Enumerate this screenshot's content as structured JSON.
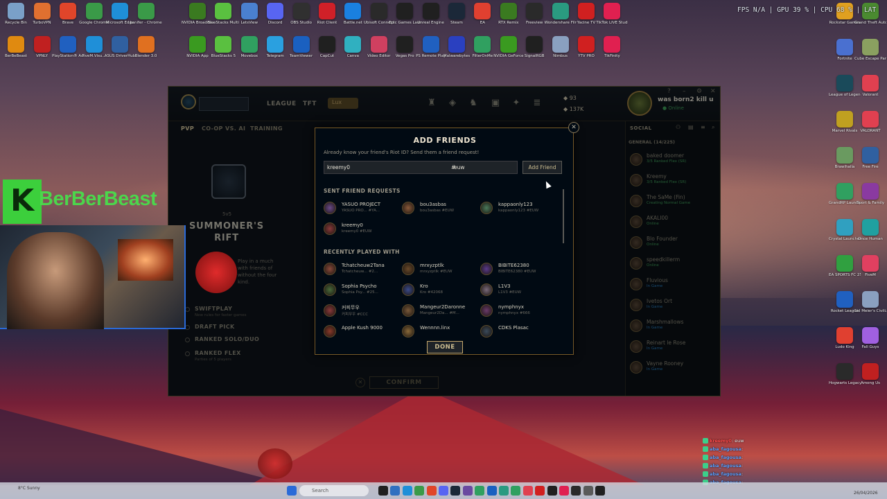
{
  "desktop": {
    "icons_left": [
      {
        "label": "Recycle Bin",
        "color": "#7aa0c8"
      },
      {
        "label": "TurboVPN",
        "color": "#e07030"
      },
      {
        "label": "Brave",
        "color": "#e0452a"
      },
      {
        "label": "Google Chrome",
        "color": "#3a9a48"
      },
      {
        "label": "Microsoft Edge",
        "color": "#1f8fd8"
      },
      {
        "label": "kanifer - Chrome",
        "color": "#3a9a48"
      }
    ],
    "icons_left_row2": [
      {
        "label": "BerBeBeast",
        "color": "#e08a10"
      },
      {
        "label": "VPNLY",
        "color": "#c02020"
      },
      {
        "label": "PlayStation® Accessories",
        "color": "#2060c0"
      },
      {
        "label": "FiveM.Visu...",
        "color": "#1f8fd8"
      },
      {
        "label": "ASUS DriverHub",
        "color": "#3060a0"
      },
      {
        "label": "Blender 3.0",
        "color": "#e07020"
      }
    ],
    "icons_top_row1": [
      {
        "label": "NVIDIA Broadcast",
        "color": "#3a7a20"
      },
      {
        "label": "BlueStacks Multi-Insta...",
        "color": "#5ac040"
      },
      {
        "label": "LetsView",
        "color": "#4a80d0"
      },
      {
        "label": "Discord",
        "color": "#5865f2"
      },
      {
        "label": "OBS Studio",
        "color": "#303030"
      },
      {
        "label": "Riot Client",
        "color": "#d02028"
      },
      {
        "label": "Battle.net",
        "color": "#1a80e0"
      },
      {
        "label": "Ubisoft Connect",
        "color": "#2a2a2a"
      },
      {
        "label": "Epic Games Launcher",
        "color": "#202020"
      },
      {
        "label": "Unreal Engine",
        "color": "#202020"
      },
      {
        "label": "Steam",
        "color": "#1b2838"
      },
      {
        "label": "EA",
        "color": "#e04030"
      },
      {
        "label": "RTX Remix",
        "color": "#3a7a20"
      },
      {
        "label": "Freeview",
        "color": "#2a2a2a"
      },
      {
        "label": "Wondershare Filmora 15",
        "color": "#2a9a80"
      },
      {
        "label": "Yacine TV",
        "color": "#d02020"
      },
      {
        "label": "TikTok LIVE Studio",
        "color": "#e02050"
      }
    ],
    "icons_top_row2": [
      {
        "label": "NVIDIA App",
        "color": "#3a9a20"
      },
      {
        "label": "BlueStacks 5",
        "color": "#5ac040"
      },
      {
        "label": "Movebox",
        "color": "#30a060"
      },
      {
        "label": "Telegram",
        "color": "#2aa0e0"
      },
      {
        "label": "TeamViewer",
        "color": "#1a60c0"
      },
      {
        "label": "CapCut",
        "color": "#202020"
      },
      {
        "label": "Canva",
        "color": "#30b0c0"
      },
      {
        "label": "Video Editor",
        "color": "#d04060"
      },
      {
        "label": "Vegas Pro",
        "color": "#202020"
      },
      {
        "label": "PS Remote Play",
        "color": "#2060c0"
      },
      {
        "label": "Malwarebytes",
        "color": "#2a40c0"
      },
      {
        "label": "FilterOnMe",
        "color": "#30a060"
      },
      {
        "label": "NVIDIA GeForce",
        "color": "#3a9a20"
      },
      {
        "label": "SignalRGB",
        "color": "#202020"
      },
      {
        "label": "Nimbus",
        "color": "#8aa0c0"
      },
      {
        "label": "YTV PRO",
        "color": "#d02020"
      },
      {
        "label": "TikFinity",
        "color": "#e02050"
      }
    ],
    "icons_right": [
      {
        "label": "Rockstar Games",
        "color": "#e0a020"
      },
      {
        "label": "Grand Theft Auto V En...",
        "color": "#4a8a30"
      },
      {
        "label": "Fortnite",
        "color": "#4a70d0"
      },
      {
        "label": "Cube Escape Paradox",
        "color": "#8aa060"
      },
      {
        "label": "League of Legends",
        "color": "#1a4a5a"
      },
      {
        "label": "Valorant",
        "color": "#e04050"
      },
      {
        "label": "Marvel Rivals",
        "color": "#c0a020"
      },
      {
        "label": "VALORANT",
        "color": "#e04050"
      },
      {
        "label": "Brawlhalla",
        "color": "#6a9a60"
      },
      {
        "label": "Free Fire",
        "color": "#3060a0"
      },
      {
        "label": "GrandRP Launcher",
        "color": "#30a060"
      },
      {
        "label": "Sport & Family",
        "color": "#8a3aa0"
      },
      {
        "label": "Crystal Launcher",
        "color": "#30a0c0"
      },
      {
        "label": "Once Human",
        "color": "#20a0a0"
      },
      {
        "label": "EA SPORTS FC 25",
        "color": "#30a040"
      },
      {
        "label": "FiveM",
        "color": "#e04060"
      },
      {
        "label": "Rocket League",
        "color": "#2060c0"
      },
      {
        "label": "Sid Meier's Civilization VI",
        "color": "#8aa0c0"
      },
      {
        "label": "Ludo King",
        "color": "#e04030"
      },
      {
        "label": "Fall Guys",
        "color": "#a060e0"
      },
      {
        "label": "Hogwarts Legacy",
        "color": "#2a2a2a"
      },
      {
        "label": "Among Us",
        "color": "#c02020"
      }
    ]
  },
  "perf": {
    "text": "FPS N/A  |  GPU 39 %  |  CPU 68 %  |  LAT"
  },
  "client": {
    "nav": [
      "LEAGUE",
      "TFT"
    ],
    "rank_pill": "Lux",
    "currency_be": "93",
    "currency_rp": "137K",
    "username": "was born2 kill u",
    "status": "Online",
    "subnav": [
      "PVP",
      "CO-OP VS. AI",
      "TRAINING"
    ],
    "mode_count": "5v5",
    "mode_title": "SUMMONER'S RIFT",
    "mode_desc": "Play in a much with friends of without the four kind.",
    "queues": [
      {
        "name": "SWIFTPLAY",
        "sub": "New rules for faster games"
      },
      {
        "name": "DRAFT PICK",
        "sub": ""
      },
      {
        "name": "RANKED SOLO/DUO",
        "sub": ""
      },
      {
        "name": "RANKED FLEX",
        "sub": "Parties of 5 players"
      }
    ],
    "confirm": "CONFIRM",
    "social": {
      "header": "SOCIAL",
      "group": "GENERAL (14/225)",
      "friends": [
        {
          "name": "baked doomer",
          "status": "3/5 Ranked Flex (SR)",
          "color": "#3fa05b"
        },
        {
          "name": "Kreemy",
          "status": "3/5 Ranked Flex (SR)",
          "color": "#3fa05b"
        },
        {
          "name": "The SaMe (Fin)",
          "status": "Creating Normal Game",
          "color": "#3fa05b"
        },
        {
          "name": "AKALI00",
          "status": "Online",
          "color": "#3fa05b"
        },
        {
          "name": "Blo Founder",
          "status": "Online",
          "color": "#3fa05b"
        },
        {
          "name": "speedkillerm",
          "status": "Online",
          "color": "#3fa05b"
        },
        {
          "name": "Fluvious",
          "status": "In Game",
          "color": "#2a7fc0"
        },
        {
          "name": "Ivetos Ort",
          "status": "In Game",
          "color": "#2a7fc0"
        },
        {
          "name": "Marshmallows",
          "status": "In Game",
          "color": "#2a7fc0"
        },
        {
          "name": "Reinart le Rose",
          "status": "In Game",
          "color": "#2a7fc0"
        },
        {
          "name": "Vayne Rooney",
          "status": "In Game",
          "color": "#2a7fc0"
        }
      ]
    }
  },
  "modal": {
    "title": "ADD FRIENDS",
    "subtitle": "Already know your friend's Riot ID? Send them a friend request!",
    "riot_id_value": "kreemy0",
    "tag_value": "euw",
    "add_button": "Add Friend",
    "sent_header": "SENT FRIEND REQUESTS",
    "sent": [
      {
        "name": "YASUO PROJECT",
        "tag": "YASUO PRO... #YA...",
        "color": "#6a4a8a"
      },
      {
        "name": "bou3asbas",
        "tag": "bou3asbas #EUW",
        "color": "#8a5a3a"
      },
      {
        "name": "kappaonly123",
        "tag": "kappaonly123 #EUW",
        "color": "#4a7a5a"
      },
      {
        "name": "kreemy0",
        "tag": "kreemy0 #EUW",
        "color": "#8a3a3a"
      }
    ],
    "recent_header": "RECENTLY PLAYED WITH",
    "recent": [
      {
        "name": "Tchatcheuw2Tana",
        "tag": "Tchatcheuw... #2...",
        "color": "#8a4a3a"
      },
      {
        "name": "mrxyzptlk",
        "tag": "mrxyzptlk #EUW",
        "color": "#6a4a2a"
      },
      {
        "name": "BIBITE62380",
        "tag": "BIBITE62380 #EUW",
        "color": "#5a3a8a"
      },
      {
        "name": "Sophia Psycho",
        "tag": "Sophia Psy... #25...",
        "color": "#4a6a3a"
      },
      {
        "name": "Kro",
        "tag": "Kro #42068",
        "color": "#3a4a8a"
      },
      {
        "name": "L1V3",
        "tag": "L1V3 #EUW",
        "color": "#7a6a7a"
      },
      {
        "name": "커피무우",
        "tag": "커피무우 #CCC",
        "color": "#8a3a3a"
      },
      {
        "name": "Mangeur2Daronne",
        "tag": "Mangeur2Da... #M...",
        "color": "#7a5a3a"
      },
      {
        "name": "nymphnyx",
        "tag": "nymphnyx #666",
        "color": "#6a3a6a"
      },
      {
        "name": "Apple Kush 9000",
        "tag": "",
        "color": "#8a3a2a"
      },
      {
        "name": "Wennnn.linx",
        "tag": "",
        "color": "#8a6a3a"
      },
      {
        "name": "CDKS Plasac",
        "tag": "",
        "color": "#3a4a5a"
      }
    ],
    "done_button": "DONE"
  },
  "overlay": {
    "brand_k": "K",
    "brand_text": "BerBerBeast"
  },
  "chat": [
    {
      "user": "kreemy0",
      "msg": ": euw",
      "red": true
    },
    {
      "user": "aba_fagousa",
      "msg": ":",
      "red": false
    },
    {
      "user": "aba_fagousa",
      "msg": ":",
      "red": false
    },
    {
      "user": "aba_fagousa",
      "msg": ":",
      "red": false
    },
    {
      "user": "aba_fagousa",
      "msg": ":",
      "red": false
    },
    {
      "user": "aba_fagousa",
      "msg": ":",
      "red": false
    }
  ],
  "taskbar": {
    "search_placeholder": "Search",
    "weather": "8°C Sunny",
    "time": "",
    "date": "26/04/2026",
    "app_colors": [
      "#202020",
      "#3070c0",
      "#1f8fd8",
      "#3a9a48",
      "#e0452a",
      "#5865f2",
      "#1b2838",
      "#6a4aa0",
      "#30a060",
      "#1a60c0",
      "#2a9a80",
      "#30a060",
      "#e04050",
      "#d02020",
      "#202020",
      "#e02050",
      "#2a2a2a",
      "#5a5a5a",
      "#202020"
    ]
  }
}
